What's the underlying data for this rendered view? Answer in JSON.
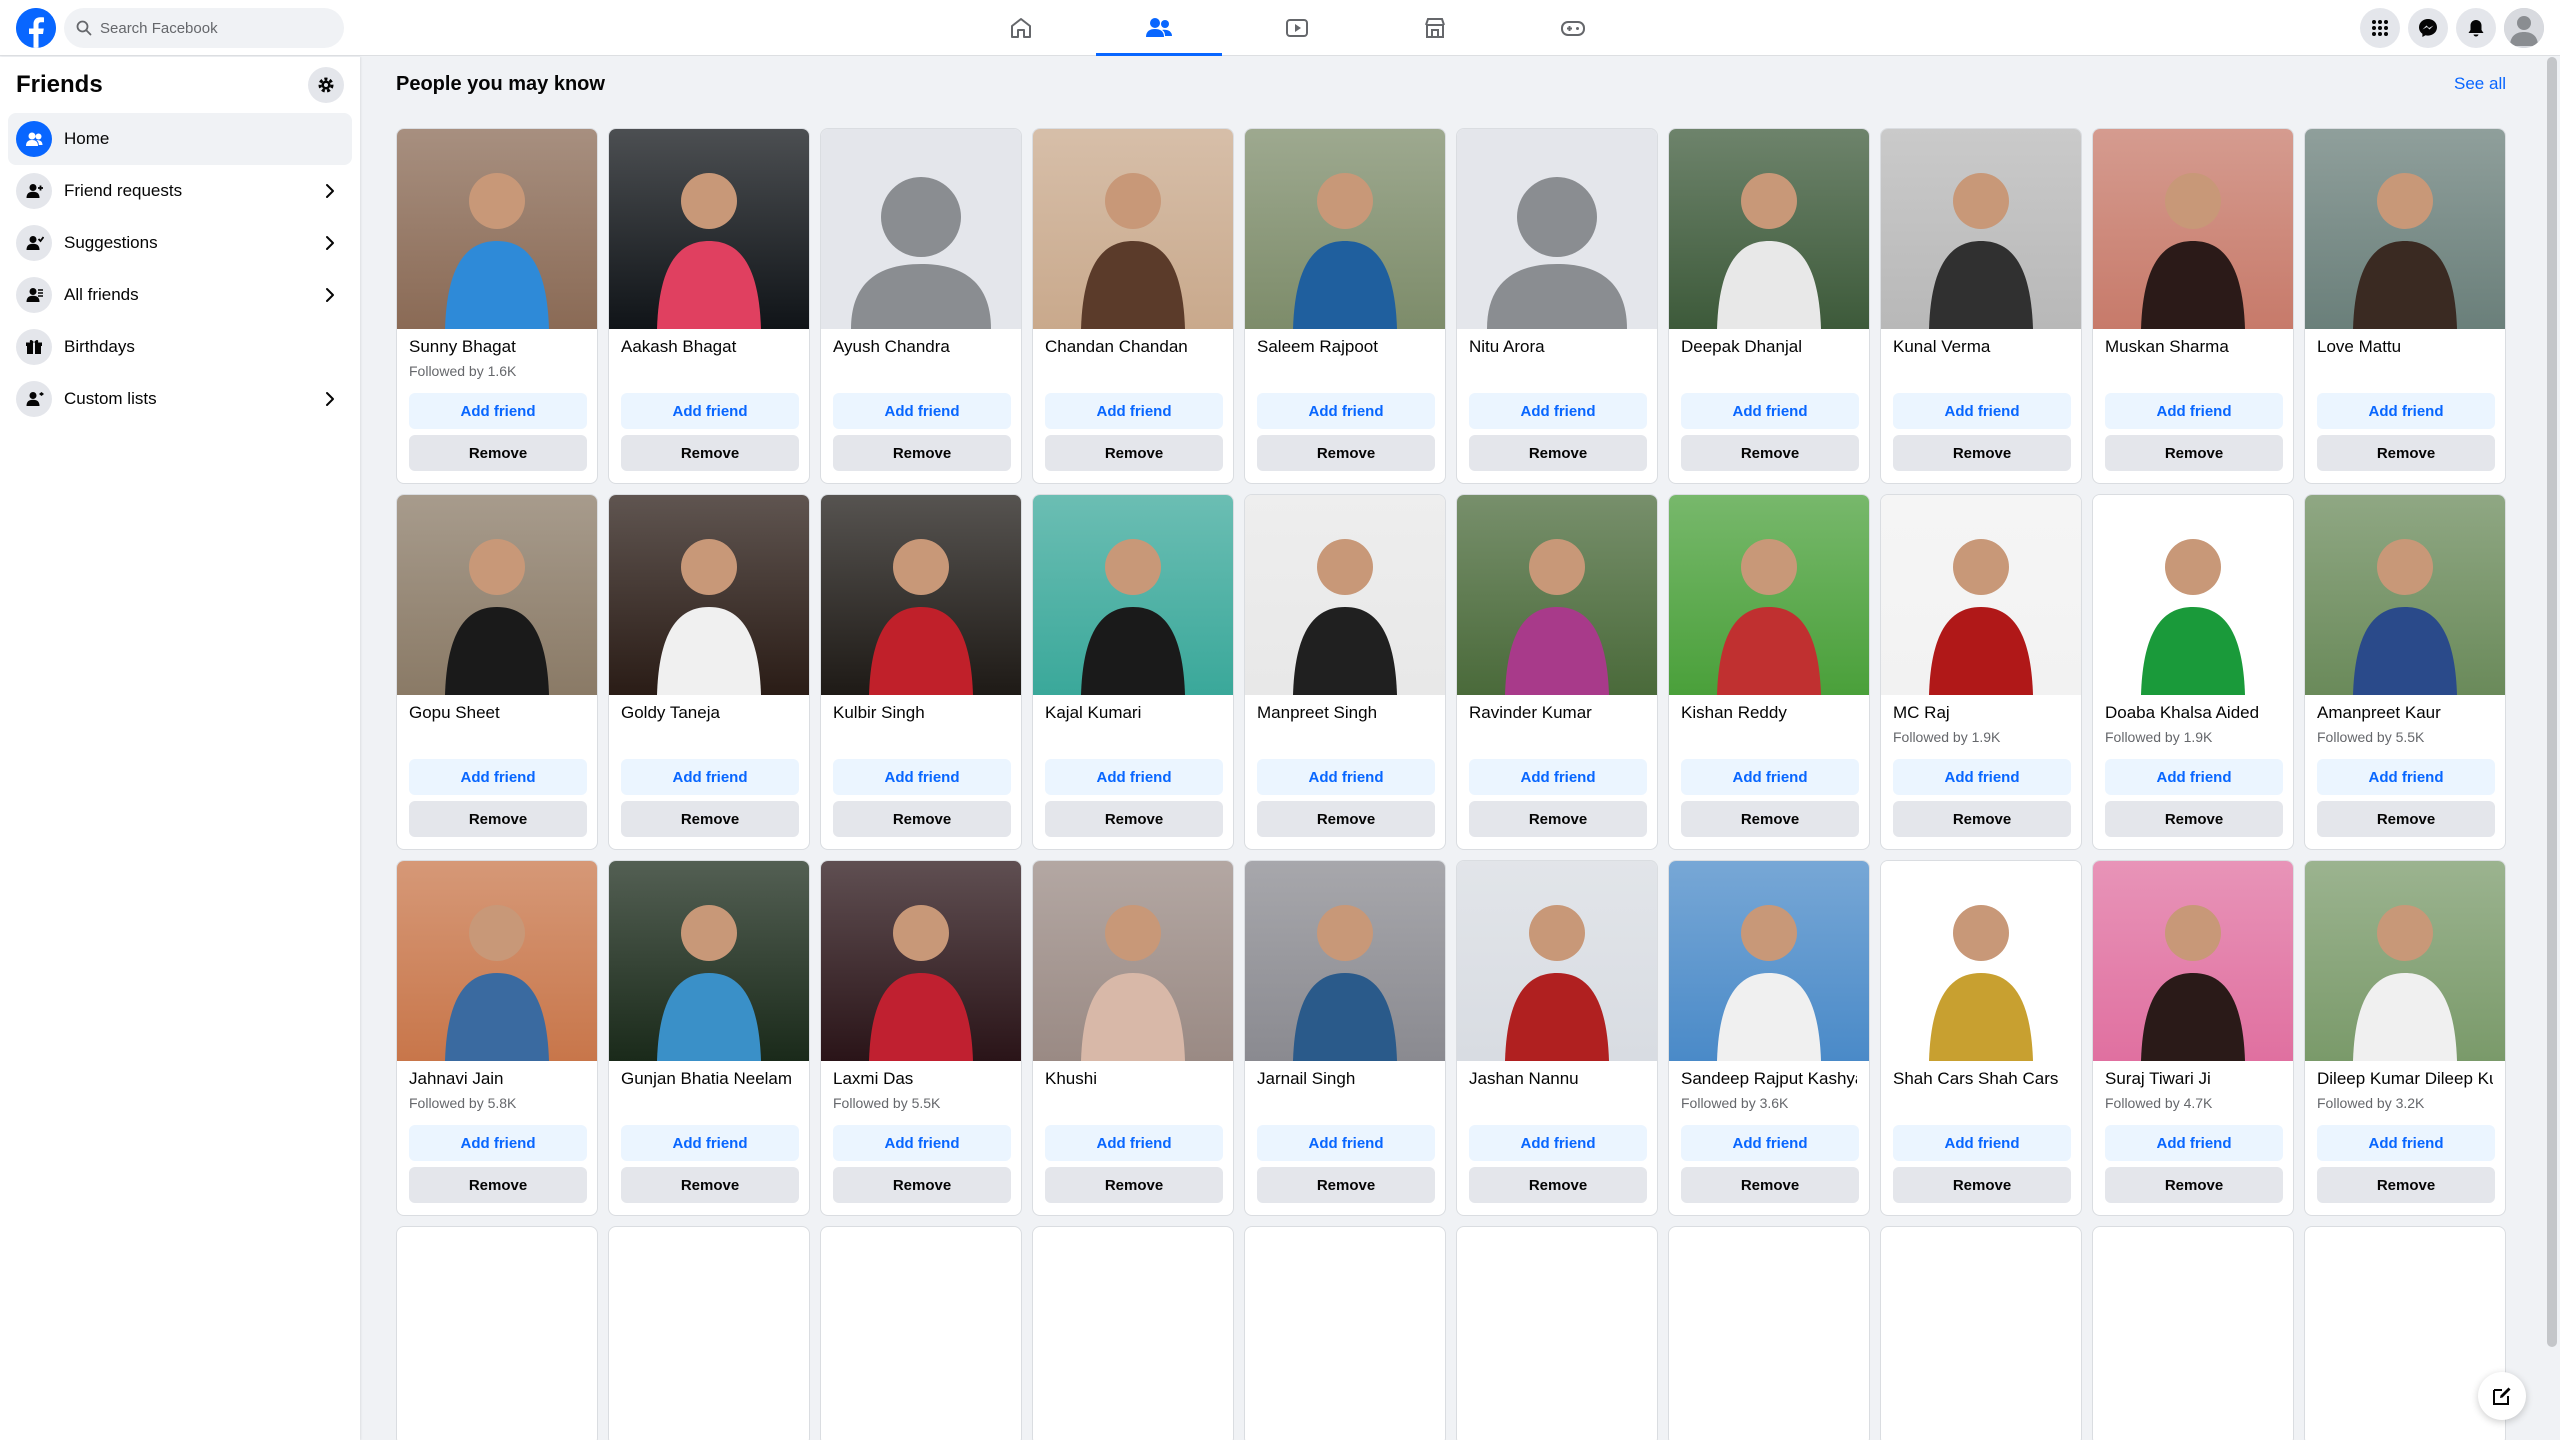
{
  "search": {
    "placeholder": "Search Facebook"
  },
  "nav": {
    "tabs": [
      {
        "icon": "home-icon",
        "active": false
      },
      {
        "icon": "friends-icon",
        "active": true
      },
      {
        "icon": "video-icon",
        "active": false
      },
      {
        "icon": "marketplace-icon",
        "active": false
      },
      {
        "icon": "gaming-icon",
        "active": false
      }
    ]
  },
  "sidebar": {
    "title": "Friends",
    "items": [
      {
        "label": "Home",
        "icon": "friends-home-icon",
        "active": true,
        "chevron": false
      },
      {
        "label": "Friend requests",
        "icon": "friend-requests-icon",
        "active": false,
        "chevron": true
      },
      {
        "label": "Suggestions",
        "icon": "suggestions-icon",
        "active": false,
        "chevron": true
      },
      {
        "label": "All friends",
        "icon": "all-friends-icon",
        "active": false,
        "chevron": true
      },
      {
        "label": "Birthdays",
        "icon": "gift-icon",
        "active": false,
        "chevron": false
      },
      {
        "label": "Custom lists",
        "icon": "custom-lists-icon",
        "active": false,
        "chevron": true
      }
    ]
  },
  "main": {
    "section_title": "People you may know",
    "see_all": "See all",
    "add_label": "Add friend",
    "remove_label": "Remove",
    "people": [
      {
        "name": "Sunny Bhagat",
        "followers": "Followed by 1.6K",
        "bg": "#8a6a55",
        "fg": "#2e8ad8",
        "default": false
      },
      {
        "name": "Aakash Bhagat",
        "followers": "",
        "bg": "#101418",
        "fg": "#e04060",
        "default": false
      },
      {
        "name": "Ayush Chandra",
        "followers": "",
        "bg": "#e4e6eb",
        "fg": "#8a8d91",
        "default": true
      },
      {
        "name": "Chandan Chandan",
        "followers": "",
        "bg": "#c9a98c",
        "fg": "#5b3b2a",
        "default": false
      },
      {
        "name": "Saleem Rajpoot",
        "followers": "",
        "bg": "#7d8c6a",
        "fg": "#1f5f9e",
        "default": false
      },
      {
        "name": "Nitu Arora",
        "followers": "",
        "bg": "#e4e6eb",
        "fg": "#8a8d91",
        "default": true
      },
      {
        "name": "Deepak Dhanjal",
        "followers": "",
        "bg": "#3d5a3a",
        "fg": "#e8e8e8",
        "default": false
      },
      {
        "name": "Kunal Verma",
        "followers": "",
        "bg": "#b8b8b8",
        "fg": "#303030",
        "default": false
      },
      {
        "name": "Muskan Sharma",
        "followers": "",
        "bg": "#c77a6a",
        "fg": "#2b1a18",
        "default": false
      },
      {
        "name": "Love Mattu",
        "followers": "",
        "bg": "#6a7f7a",
        "fg": "#3a2a22",
        "default": false
      },
      {
        "name": "Gopu Sheet",
        "followers": "",
        "bg": "#8a7a66",
        "fg": "#1a1a1a",
        "default": false
      },
      {
        "name": "Goldy Taneja",
        "followers": "",
        "bg": "#2a1c16",
        "fg": "#f0f0f0",
        "default": false
      },
      {
        "name": "Kulbir Singh",
        "followers": "",
        "bg": "#1e1a16",
        "fg": "#c0202a",
        "default": false
      },
      {
        "name": "Kajal Kumari",
        "followers": "",
        "bg": "#3aa89a",
        "fg": "#1a1a1a",
        "default": false
      },
      {
        "name": "Manpreet Singh",
        "followers": "",
        "bg": "#e8e8e8",
        "fg": "#202020",
        "default": false
      },
      {
        "name": "Ravinder Kumar",
        "followers": "",
        "bg": "#4a6a3a",
        "fg": "#a83a8a",
        "default": false
      },
      {
        "name": "Kishan Reddy",
        "followers": "",
        "bg": "#4aa03a",
        "fg": "#c03030",
        "default": false
      },
      {
        "name": "MC Raj",
        "followers": "Followed by 1.9K",
        "bg": "#f2f2f2",
        "fg": "#b01818",
        "default": false
      },
      {
        "name": "Doaba Khalsa Aided",
        "followers": "Followed by 1.9K",
        "bg": "#ffffff",
        "fg": "#1a9a3a",
        "default": false
      },
      {
        "name": "Amanpreet Kaur",
        "followers": "Followed by 5.5K",
        "bg": "#6a8a5a",
        "fg": "#2a4a8a",
        "default": false
      },
      {
        "name": "Jahnavi Jain",
        "followers": "Followed by 5.8K",
        "bg": "#c8764a",
        "fg": "#3a6aa0",
        "default": false
      },
      {
        "name": "Gunjan Bhatia Neelam",
        "followers": "",
        "bg": "#1a2a1a",
        "fg": "#3a90c8",
        "default": false
      },
      {
        "name": "Laxmi Das",
        "followers": "Followed by 5.5K",
        "bg": "#2a1418",
        "fg": "#c02030",
        "default": false
      },
      {
        "name": "Khushi",
        "followers": "",
        "bg": "#9a8a84",
        "fg": "#d8b8a8",
        "default": false
      },
      {
        "name": "Jarnail Singh",
        "followers": "",
        "bg": "#8a8a90",
        "fg": "#2a5a8a",
        "default": false
      },
      {
        "name": "Jashan Nannu",
        "followers": "",
        "bg": "#d8dce2",
        "fg": "#b02020",
        "default": false
      },
      {
        "name": "Sandeep Rajput Kashyap",
        "followers": "Followed by 3.6K",
        "bg": "#4a8ac8",
        "fg": "#f0f0f0",
        "default": false
      },
      {
        "name": "Shah Cars Shah Cars",
        "followers": "",
        "bg": "#ffffff",
        "fg": "#c8a030",
        "default": false
      },
      {
        "name": "Suraj Tiwari Ji",
        "followers": "Followed by 4.7K",
        "bg": "#e070a0",
        "fg": "#2a1a18",
        "default": false
      },
      {
        "name": "Dileep Kumar Dileep Kumar",
        "followers": "Followed by 3.2K",
        "bg": "#7a9a6a",
        "fg": "#f0f0f0",
        "default": false
      }
    ]
  }
}
